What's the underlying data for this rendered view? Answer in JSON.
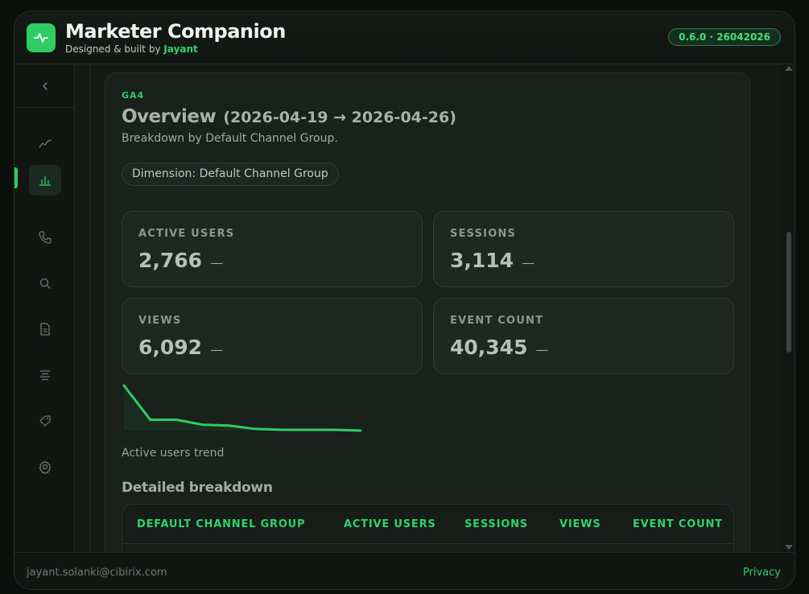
{
  "app": {
    "title": "Marketer Companion",
    "subtitle_prefix": "Designed & built by",
    "author": "Jayant",
    "version": "0.6.0 · 26042026"
  },
  "sidebar": {
    "items": [
      {
        "icon": "trend-line-icon"
      },
      {
        "icon": "bar-chart-icon",
        "active": true
      },
      {
        "icon": "phone-icon"
      },
      {
        "icon": "search-icon"
      },
      {
        "icon": "document-icon"
      },
      {
        "icon": "align-center-icon"
      },
      {
        "icon": "tag-icon"
      },
      {
        "icon": "gear-icon"
      }
    ]
  },
  "overview": {
    "source": "GA4",
    "title": "Overview",
    "date_range": "(2026-04-19 → 2026-04-26)",
    "subtitle": "Breakdown by Default Channel Group.",
    "dimension_chip": "Dimension: Default Channel Group"
  },
  "kpis": [
    {
      "label": "ACTIVE USERS",
      "value": "2,766",
      "delta": "—"
    },
    {
      "label": "SESSIONS",
      "value": "3,114",
      "delta": "—"
    },
    {
      "label": "VIEWS",
      "value": "6,092",
      "delta": "—"
    },
    {
      "label": "EVENT COUNT",
      "value": "40,345",
      "delta": "—"
    }
  ],
  "trend": {
    "label": "Active users trend",
    "values": [
      54,
      13,
      13,
      7,
      6,
      2,
      1,
      1,
      1,
      0
    ]
  },
  "breakdown": {
    "title": "Detailed breakdown",
    "columns": [
      "DEFAULT CHANNEL GROUP",
      "ACTIVE USERS",
      "SESSIONS",
      "VIEWS",
      "EVENT COUNT"
    ]
  },
  "footer": {
    "email": "jayant.solanki@cibirix.com",
    "privacy": "Privacy"
  },
  "colors": {
    "accent": "#2ecc65",
    "background": "#121714"
  }
}
